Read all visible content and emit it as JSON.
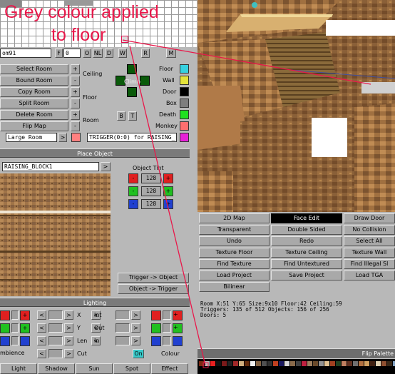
{
  "annotation": {
    "line1": "Grey colour applied",
    "line2": "to floor"
  },
  "room_bar": {
    "room_name": "om91",
    "btn_f": "F",
    "value": "0",
    "btn_o": "O",
    "btn_nl": "NL",
    "btn_d": "D",
    "btn_w": "W",
    "btn_r": "R",
    "btn_m": "M"
  },
  "room_buttons": [
    "Select Room",
    "Bound Room",
    "Copy Room",
    "Split Room",
    "Delete Room",
    "Flip Map"
  ],
  "room_size": "Large Room",
  "sector_labels": {
    "ceiling": "Ceiling",
    "floor": "Floor",
    "room": "Room",
    "climb": "Climb",
    "b": "B",
    "t": "T"
  },
  "sector_steppers": [
    "+",
    "-",
    "+",
    "-",
    "+",
    "-"
  ],
  "flags": [
    {
      "label": "Floor",
      "color": "#36d1e0"
    },
    {
      "label": "Wall",
      "color": "#e4e33b"
    },
    {
      "label": "Door",
      "color": "#000000"
    },
    {
      "label": "Box",
      "color": "#7e7e7e"
    },
    {
      "label": "Death",
      "color": "#21e121"
    },
    {
      "label": "Monkey",
      "color": "#ff6f6f"
    },
    {
      "label": "",
      "color": "#e721d8"
    }
  ],
  "room_color_swatch": "#ff8080",
  "trigger_field": "TRIGGER(0:0) for RAISING_",
  "place_object": {
    "title": "Place Object",
    "object_name": "RAISING_BLOCK1",
    "nav": ">",
    "tint_label": "Object Tint",
    "tint_values": [
      "128",
      "128",
      "128"
    ],
    "tint_minus": "-",
    "tint_plus": "+"
  },
  "trigger_buttons": [
    "Trigger -> Object",
    "Object -> Trigger"
  ],
  "lighting": {
    "title": "Lighting",
    "axes": [
      "X",
      "Y",
      "Len",
      "Cut"
    ],
    "params": [
      "Int",
      "Out",
      "In"
    ],
    "ambience": "mbience",
    "on": "On",
    "colour": "Colour",
    "bottom_tabs": [
      "Light",
      "Shadow",
      "Sun",
      "Spot",
      "Effect"
    ],
    "arrows": [
      "<",
      ">"
    ]
  },
  "tool_buttons": [
    [
      "2D Map",
      "Face Edit",
      "Draw Door"
    ],
    [
      "Transparent",
      "Double Sided",
      "No Collision"
    ],
    [
      "Undo",
      "Redo",
      "Select All"
    ],
    [
      "Texture Floor",
      "Texture Ceiling",
      "Texture Wall"
    ],
    [
      "Find Texture",
      "Find Untextured",
      "Find Illegal Sl"
    ],
    [
      "Load Project",
      "Save Project",
      "Load TGA"
    ],
    [
      "Bilinear",
      "",
      ""
    ]
  ],
  "active_tool": "Face Edit",
  "status": {
    "line1": "Room X:51 Y:65   Size:9x10    Floor:42 Ceiling:59",
    "line2": "Triggers: 135 of 512 Objects: 156 of 256",
    "line3": "Doors: 5"
  },
  "flip_palette": "Flip Palette",
  "palette": [
    "#7a2a14",
    "#b8b8b8",
    "#e82020",
    "#101010",
    "#7a1a1a",
    "#222222",
    "#a02828",
    "#d0b080",
    "#602808",
    "#f0f0f0",
    "#806040",
    "#505050",
    "#303030",
    "#c04020",
    "#1a1a60",
    "#d8d8d8",
    "#8a6a4a",
    "#404040",
    "#c02040",
    "#a08060",
    "#6a4a2a",
    "#909090",
    "#e0c090",
    "#a04020",
    "#204020",
    "#c08060",
    "#603020",
    "#707070",
    "#b07040",
    "#d0a060",
    "#402010",
    "#e0d0b0",
    "#905030",
    "#382818",
    "#80a0c0",
    "#c0a080",
    "#504030",
    "#a0a0a0",
    "#8a5030",
    "#e8e0d0",
    "#604830",
    "#c09060",
    "#3a3a3a",
    "#b89070",
    "#7a6050",
    "#d8c8a8",
    "#5a3820",
    "#9a8070",
    "#c8b090",
    "#202020",
    "#e0e0e0",
    "#a07050",
    "#705040",
    "#b0b0b0",
    "#8a3820",
    "#d0d0d0",
    "#504848",
    "#c8a070",
    "#905838",
    "#f0e8d8",
    "#684828",
    "#404040",
    "#a89880",
    "#785838"
  ]
}
